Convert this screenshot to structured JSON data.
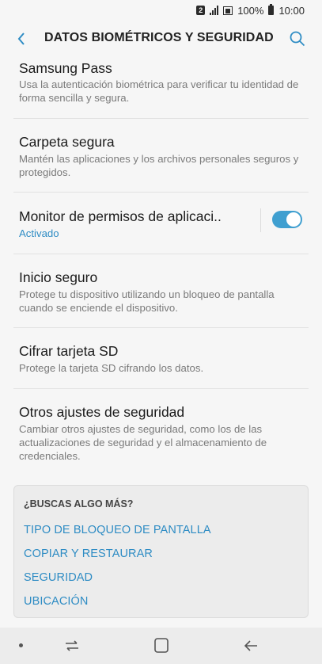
{
  "status_bar": {
    "sim_label": "2",
    "battery": "100%",
    "time": "10:00"
  },
  "app_bar": {
    "title": "DATOS BIOMÉTRICOS Y SEGURIDAD",
    "back_icon": "chevron-left-icon",
    "search_icon": "search-icon"
  },
  "settings": [
    {
      "title": "Samsung Pass",
      "subtitle": "Usa la autenticación biométrica para verificar tu identidad de forma sencilla y segura."
    },
    {
      "title": "Carpeta segura",
      "subtitle": "Mantén las aplicaciones y los archivos personales seguros y protegidos."
    },
    {
      "title": "Monitor de permisos de aplicaci..",
      "subtitle": "Activado",
      "toggle_on": true
    },
    {
      "title": "Inicio seguro",
      "subtitle": "Protege tu dispositivo utilizando un bloqueo de pantalla cuando se enciende el dispositivo."
    },
    {
      "title": "Cifrar tarjeta SD",
      "subtitle": "Protege la tarjeta SD cifrando los datos."
    },
    {
      "title": "Otros ajustes de seguridad",
      "subtitle": "Cambiar otros ajustes de seguridad, como los de las actualizaciones de seguridad y el almacenamiento de credenciales."
    }
  ],
  "suggestions": {
    "heading": "¿BUSCAS ALGO MÁS?",
    "links": [
      "TIPO DE BLOQUEO DE PANTALLA",
      "COPIAR Y RESTAURAR",
      "SEGURIDAD",
      "UBICACIÓN"
    ]
  },
  "nav_bar": {
    "icons": [
      "recents-icon",
      "home-icon",
      "back-icon"
    ]
  },
  "colors": {
    "accent": "#2e8cc4",
    "toggle_on": "#3f9fd0",
    "background": "#f6f6f6"
  }
}
